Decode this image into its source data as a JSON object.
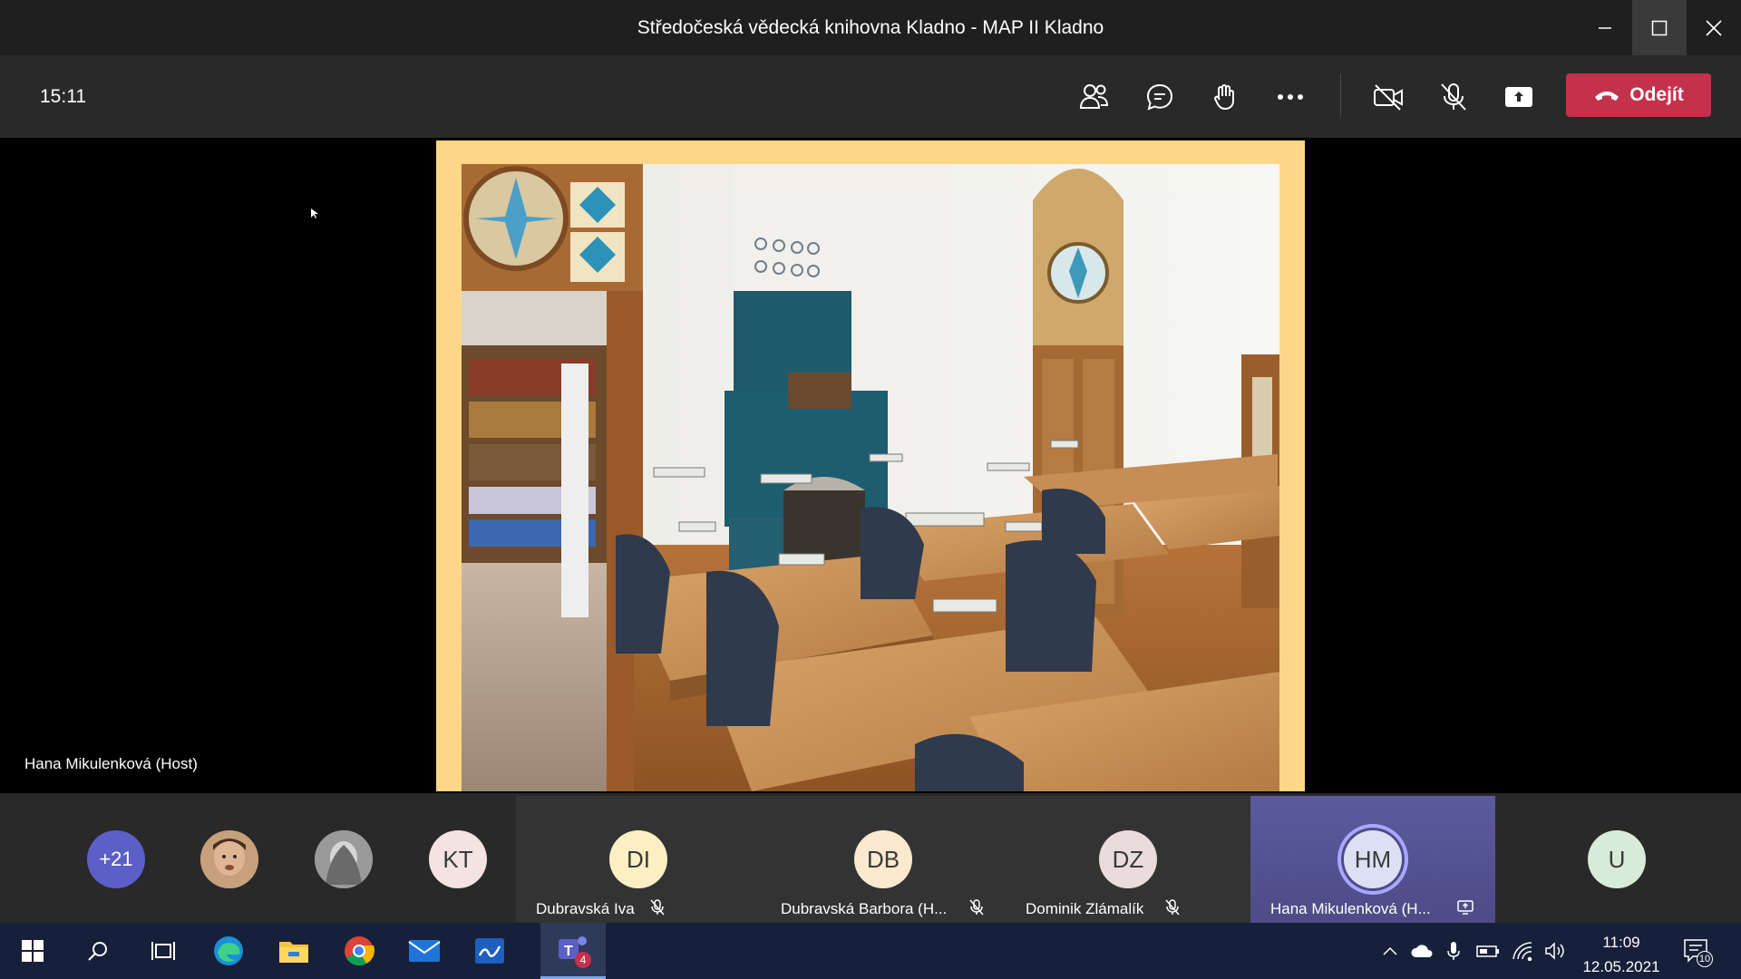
{
  "window": {
    "title": "Středočeská vědecká knihovna Kladno - MAP II Kladno"
  },
  "toolbar": {
    "timer": "15:11",
    "leave_label": "Odejít",
    "icons": [
      "people-icon",
      "chat-icon",
      "raise-hand-icon",
      "more-icon",
      "camera-off-icon",
      "mic-off-icon",
      "share-screen-icon"
    ]
  },
  "stage": {
    "presenter_label": "Hana Mikulenková (Host)",
    "slide_frame_color": "#fdd787"
  },
  "participants": {
    "overflow_count": "+21",
    "kt_initials": "KT",
    "u_initials": "U",
    "tiles": [
      {
        "initials": "DI",
        "name": "Dubravská Iva",
        "avatar_color": "#fcefc3"
      },
      {
        "initials": "DB",
        "name": "Dubravská Barbora (H...",
        "avatar_color": "#fbe9cf"
      },
      {
        "initials": "DZ",
        "name": "Dominik Zlámalík",
        "avatar_color": "#eadcdc"
      },
      {
        "initials": "HM",
        "name": "Hana Mikulenková (H...",
        "avatar_color": "#dde0f3"
      }
    ]
  },
  "taskbar": {
    "time": "11:09",
    "date": "12.05.2021",
    "teams_badge": "4",
    "notifications_count": "10",
    "accent": "#16203a"
  }
}
